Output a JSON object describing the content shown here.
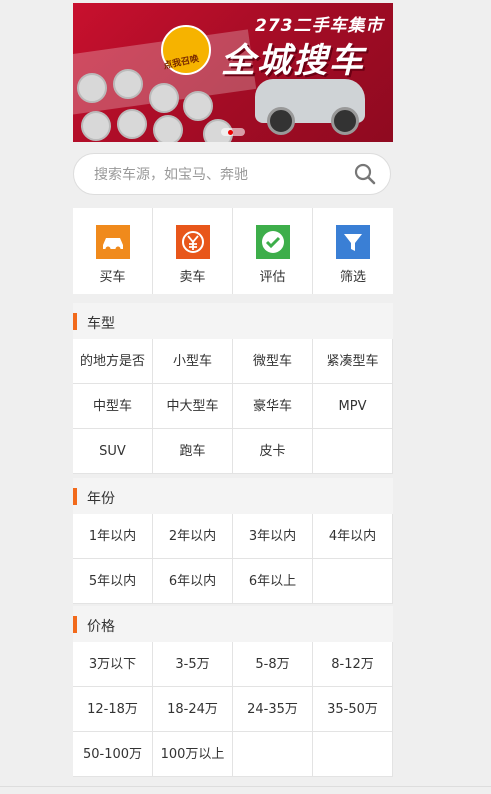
{
  "banner": {
    "line1": "273二手车集市",
    "line2": "全城搜车",
    "badge": "点我召唤"
  },
  "search": {
    "placeholder": "搜索车源，如宝马、奔驰",
    "icon": "search-icon"
  },
  "quick": [
    {
      "label": "买车",
      "icon": "car-icon",
      "color": "#f08a1c"
    },
    {
      "label": "卖车",
      "icon": "yen-icon",
      "color": "#e8561a"
    },
    {
      "label": "评估",
      "icon": "check-icon",
      "color": "#3dae4a"
    },
    {
      "label": "筛选",
      "icon": "filter-icon",
      "color": "#3a7fd5"
    }
  ],
  "sections": {
    "type": {
      "title": "车型",
      "items": [
        "的地方是否",
        "小型车",
        "微型车",
        "紧凑型车",
        "中型车",
        "中大型车",
        "豪华车",
        "MPV",
        "SUV",
        "跑车",
        "皮卡"
      ]
    },
    "year": {
      "title": "年份",
      "items": [
        "1年以内",
        "2年以内",
        "3年以内",
        "4年以内",
        "5年以内",
        "6年以内",
        "6年以上"
      ]
    },
    "price": {
      "title": "价格",
      "items": [
        "3万以下",
        "3-5万",
        "5-8万",
        "8-12万",
        "12-18万",
        "18-24万",
        "24-35万",
        "35-50万",
        "50-100万",
        "100万以上"
      ]
    }
  },
  "accent_color": "#f26a1b"
}
